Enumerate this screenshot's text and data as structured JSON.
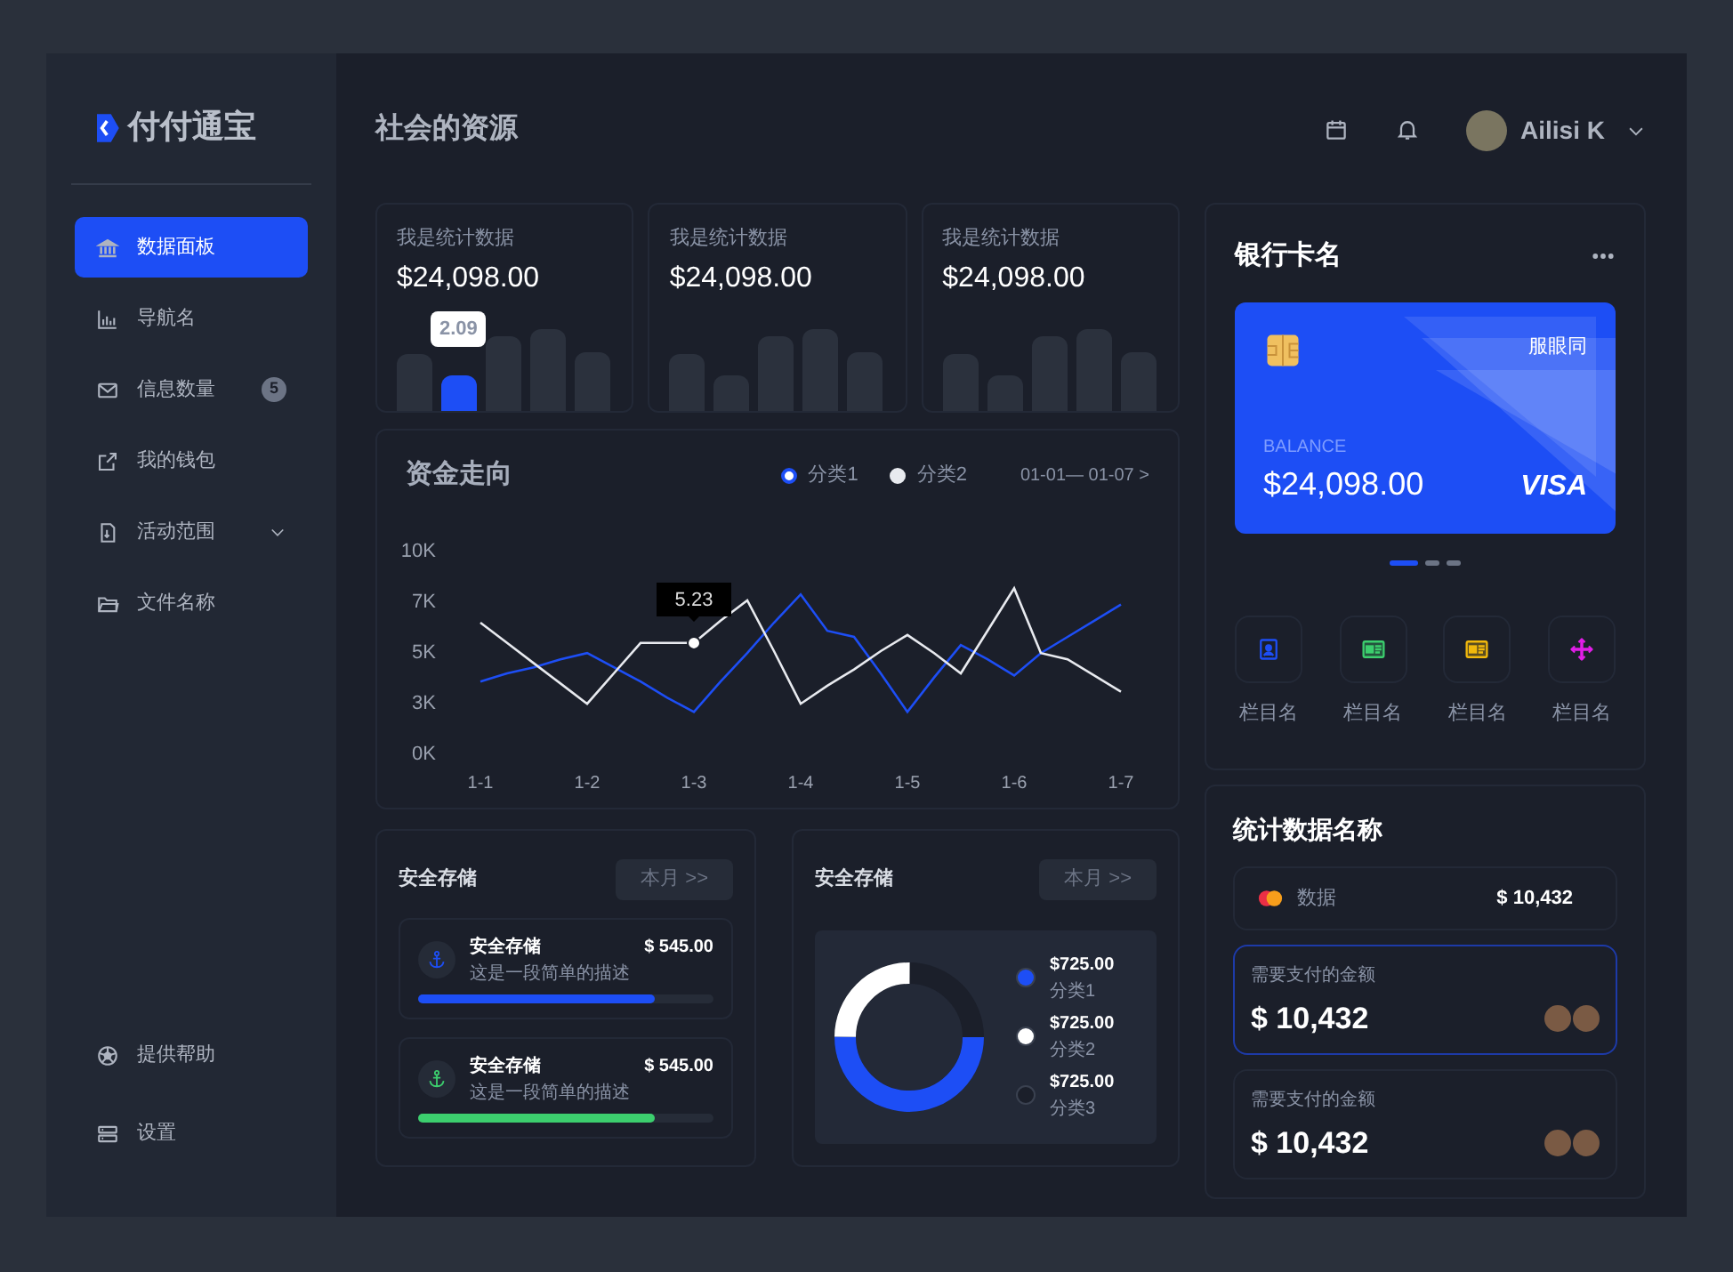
{
  "sidebar": {
    "logo": "付付通宝",
    "items": [
      {
        "kind": "bank",
        "label": "数据面板",
        "selected": true
      },
      {
        "kind": "chart",
        "label": "导航名",
        "selected": false
      },
      {
        "kind": "mail",
        "label": "信息数量",
        "selected": false,
        "badge": "5"
      },
      {
        "kind": "external",
        "label": "我的钱包",
        "selected": false
      },
      {
        "kind": "doc",
        "label": "活动范围",
        "selected": false,
        "expanded": false
      },
      {
        "kind": "folder",
        "label": "文件名称",
        "selected": false
      }
    ],
    "bottom_items": [
      {
        "kind": "ball",
        "label": "提供帮助"
      },
      {
        "kind": "server",
        "label": "设置"
      }
    ]
  },
  "header": {
    "title": "社会的资源",
    "user": "Ailisi K"
  },
  "stat_cards": [
    {
      "label": "我是统计数据",
      "value": "$24,098.00",
      "tooltip": "2.09"
    },
    {
      "label": "我是统计数据",
      "value": "$24,098.00"
    },
    {
      "label": "我是统计数据",
      "value": "$24,098.00"
    }
  ],
  "trend": {
    "title": "资金走向",
    "range": "01-01— 01-07 >",
    "chart_data": {
      "type": "line",
      "categories": [
        "1-1",
        null,
        null,
        null,
        "1-2",
        null,
        null,
        null,
        "1-3",
        null,
        null,
        null,
        "1-4",
        null,
        null,
        null,
        "1-5",
        null,
        null,
        null,
        "1-6",
        null,
        null,
        null,
        "1-7"
      ],
      "ylim": [
        0,
        10
      ],
      "yticks": [
        {
          "value": 0,
          "label": "0K"
        },
        {
          "value": 2.5,
          "label": "3K"
        },
        {
          "value": 5,
          "label": "5K"
        },
        {
          "value": 7.5,
          "label": "7K"
        },
        {
          "value": 10,
          "label": "10K"
        }
      ],
      "series": [
        {
          "name": "分类1",
          "color": "#1d4ef5",
          "values": [
            3.5,
            3.9,
            4.2,
            4.6,
            4.9,
            4.2,
            3.5,
            2.7,
            2.0,
            3.5,
            4.9,
            6.4,
            7.8,
            6.0,
            5.7,
            3.9,
            2.0,
            3.7,
            5.3,
            4.6,
            3.8,
            4.9,
            5.7,
            6.5,
            7.3
          ]
        },
        {
          "name": "分类2",
          "color": "#e8eaef",
          "values": [
            6.4,
            5.4,
            4.4,
            3.4,
            2.4,
            3.9,
            5.4,
            5.4,
            5.4,
            6.5,
            7.5,
            5.0,
            2.4,
            3.3,
            4.1,
            5.0,
            5.8,
            4.9,
            3.9,
            6.0,
            8.1,
            4.9,
            4.6,
            3.8,
            3.0
          ]
        }
      ],
      "annotations": [
        {
          "x": "1-3",
          "y": 5.4,
          "text": "5.23"
        }
      ]
    }
  },
  "savings": {
    "title": "安全存储",
    "button": "本月 >>",
    "items": [
      {
        "title": "安全存储",
        "desc": "这是一段简单的描述",
        "amount": "$ 545.00",
        "level": 0.8,
        "color": "#1d4ef5"
      },
      {
        "title": "安全存储",
        "desc": "这是一段简单的描述",
        "amount": "$ 545.00",
        "level": 0.8,
        "color": "#3ccf6e"
      }
    ]
  },
  "breakdown": {
    "title": "安全存储",
    "button": "本月 >>",
    "legend": [
      {
        "amount": "$725.00",
        "label": "分类1",
        "color": "#1d4ef5"
      },
      {
        "amount": "$725.00",
        "label": "分类2",
        "color": "#ffffff"
      },
      {
        "amount": "$725.00",
        "label": "分类3",
        "color": "#1b1f2a"
      }
    ]
  },
  "bank_card": {
    "title": "银行卡名",
    "issuer": "服眼同",
    "balance_label": "BALANCE",
    "balance": "$24,098.00",
    "brand": "VISA",
    "pages": [
      {
        "selected": true
      },
      {
        "selected": false
      },
      {
        "selected": false
      }
    ],
    "shortcuts": [
      {
        "kind": "contact",
        "label": "栏目名",
        "color": "#1d4ef5"
      },
      {
        "kind": "idcard",
        "label": "栏目名",
        "color": "#3ccf6e"
      },
      {
        "kind": "idcard",
        "label": "栏目名",
        "color": "#f2b90c"
      },
      {
        "kind": "move",
        "label": "栏目名",
        "color": "#e21ee8"
      }
    ]
  },
  "stats": {
    "title": "统计数据名称",
    "row": {
      "label": "数据",
      "amount": "$ 10,432"
    },
    "payments": [
      {
        "label": "需要支付的金额",
        "amount": "$ 10,432",
        "selected": true
      },
      {
        "label": "需要支付的金额",
        "amount": "$ 10,432",
        "selected": false
      }
    ]
  }
}
